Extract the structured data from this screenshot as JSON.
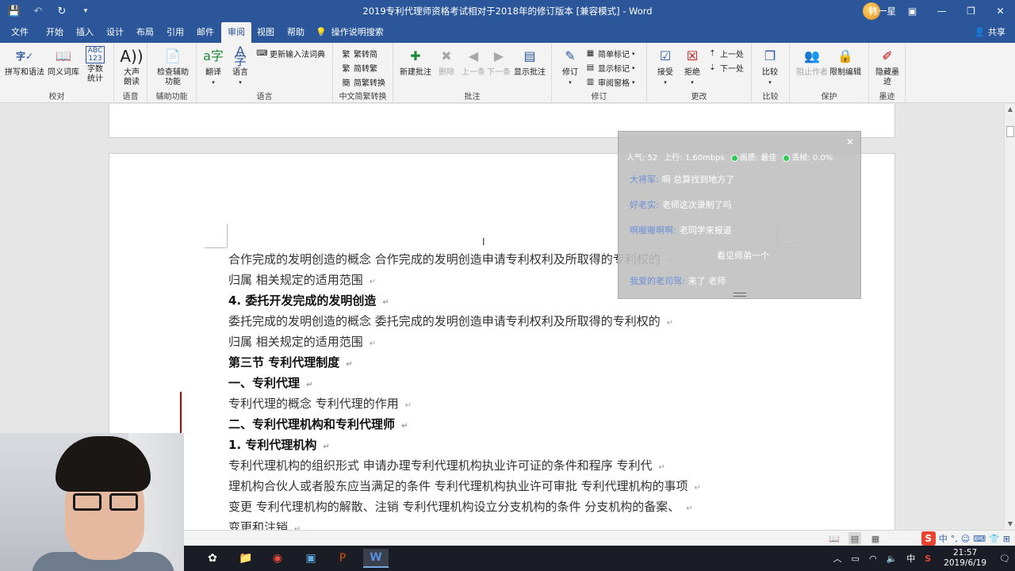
{
  "title_bar": {
    "doc_title": "2019专利代理师资格考试相对于2018年的修订版本 [兼容模式] - Word",
    "user_name": "韩一星",
    "qat_icons": [
      "save-icon",
      "undo-icon",
      "redo-icon",
      "customize-icon"
    ],
    "window_buttons": [
      "ribbon-display-icon",
      "minimize-icon",
      "restore-icon",
      "close-icon"
    ]
  },
  "tabs": [
    "文件",
    "开始",
    "插入",
    "设计",
    "布局",
    "引用",
    "邮件",
    "审阅",
    "视图",
    "帮助"
  ],
  "active_tab": "审阅",
  "tell_me": "操作说明搜索",
  "share": "共享",
  "ribbon": {
    "proofing": {
      "label": "校对",
      "buttons": [
        "拼写和语法",
        "同义词库",
        "字数统计"
      ]
    },
    "speech": {
      "label": "语音",
      "buttons": [
        "大声朗读"
      ]
    },
    "accessibility": {
      "label": "辅助功能",
      "buttons": [
        "检查辅助功能"
      ]
    },
    "language": {
      "label": "语言",
      "buttons": [
        "翻译",
        "语言"
      ],
      "small": "更新输入法词典"
    },
    "chinese_conversion": {
      "label": "中文简繁转换",
      "small": [
        "繁转简",
        "简转繁",
        "简繁转换"
      ]
    },
    "comments": {
      "label": "批注",
      "buttons": [
        "新建批注",
        "删除",
        "上一条",
        "下一条",
        "显示批注"
      ]
    },
    "tracking": {
      "label": "修订",
      "buttons": [
        "修订"
      ],
      "small": [
        "简单标记",
        "显示标记",
        "审阅窗格"
      ]
    },
    "changes": {
      "label": "更改",
      "buttons": [
        "接受",
        "拒绝"
      ],
      "small": [
        "上一处",
        "下一处"
      ]
    },
    "compare": {
      "label": "比较",
      "buttons": [
        "比较"
      ]
    },
    "protect": {
      "label": "保护",
      "buttons": [
        "阻止作者",
        "限制编辑"
      ]
    },
    "ink": {
      "label": "墨迹",
      "buttons": [
        "隐藏墨迹"
      ]
    }
  },
  "document": {
    "lines": [
      {
        "text": "合作完成的发明创造的概念  合作完成的发明创造申请专利权利及所取得的专利权的",
        "heading": false
      },
      {
        "text": "归属  相关规定的适用范围",
        "heading": false
      },
      {
        "text": "4. 委托开发完成的发明创造",
        "heading": true
      },
      {
        "text": "委托完成的发明创造的概念  委托完成的发明创造申请专利权利及所取得的专利权的",
        "heading": false
      },
      {
        "text": "归属  相关规定的适用范围",
        "heading": false
      },
      {
        "text": "第三节  专利代理制度",
        "heading": true
      },
      {
        "text": "一、专利代理",
        "heading": true
      },
      {
        "text": "专利代理的概念  专利代理的作用",
        "heading": false
      },
      {
        "text": "二、专利代理机构和专利代理师",
        "heading": true
      },
      {
        "text": "1. 专利代理机构",
        "heading": true
      },
      {
        "text": "专利代理机构的组织形式  申请办理专利代理机构执业许可证的条件和程序  专利代",
        "heading": false
      },
      {
        "text": "理机构合伙人或者股东应当满足的条件  专利代理机构执业许可审批  专利代理机构的事项",
        "heading": false
      },
      {
        "text": "变更  专利代理机构的解散、注销  专利代理机构设立分支机构的条件  分支机构的备案、",
        "heading": false
      },
      {
        "text": "变更和注销",
        "heading": false
      }
    ],
    "paragraph_mark": "↵"
  },
  "live_overlay": {
    "stats": {
      "popularity": "人气: 52",
      "upload": "上行: 1.60mbps",
      "quality": "画质: 最佳",
      "loss": "丢帧: 0.0%"
    },
    "messages": [
      {
        "user": "大将军:",
        "text": "啊 总算找到地方了"
      },
      {
        "user": "好老实:",
        "text": "老师这次录制了吗"
      },
      {
        "user": "啊喔喔啊啊:",
        "text": "老同学来报道"
      },
      {
        "user": "",
        "text": "看见师弟一个"
      },
      {
        "user": "我爱的老司驾:",
        "text": "来了 老师"
      }
    ]
  },
  "taskbar": {
    "time": "21:57",
    "date": "2019/6/19",
    "ime_lang": "中",
    "apps": [
      "windows-icon",
      "file-explorer-icon",
      "chrome-icon",
      "photos-icon",
      "powerpoint-icon",
      "word-icon"
    ]
  },
  "ime_bar": [
    "中",
    "°,",
    "☺",
    "⌨",
    "👕",
    "⊞"
  ],
  "colors": {
    "brand": "#2b579a",
    "change_bar": "#c00000",
    "sogou": "#e8442f"
  }
}
